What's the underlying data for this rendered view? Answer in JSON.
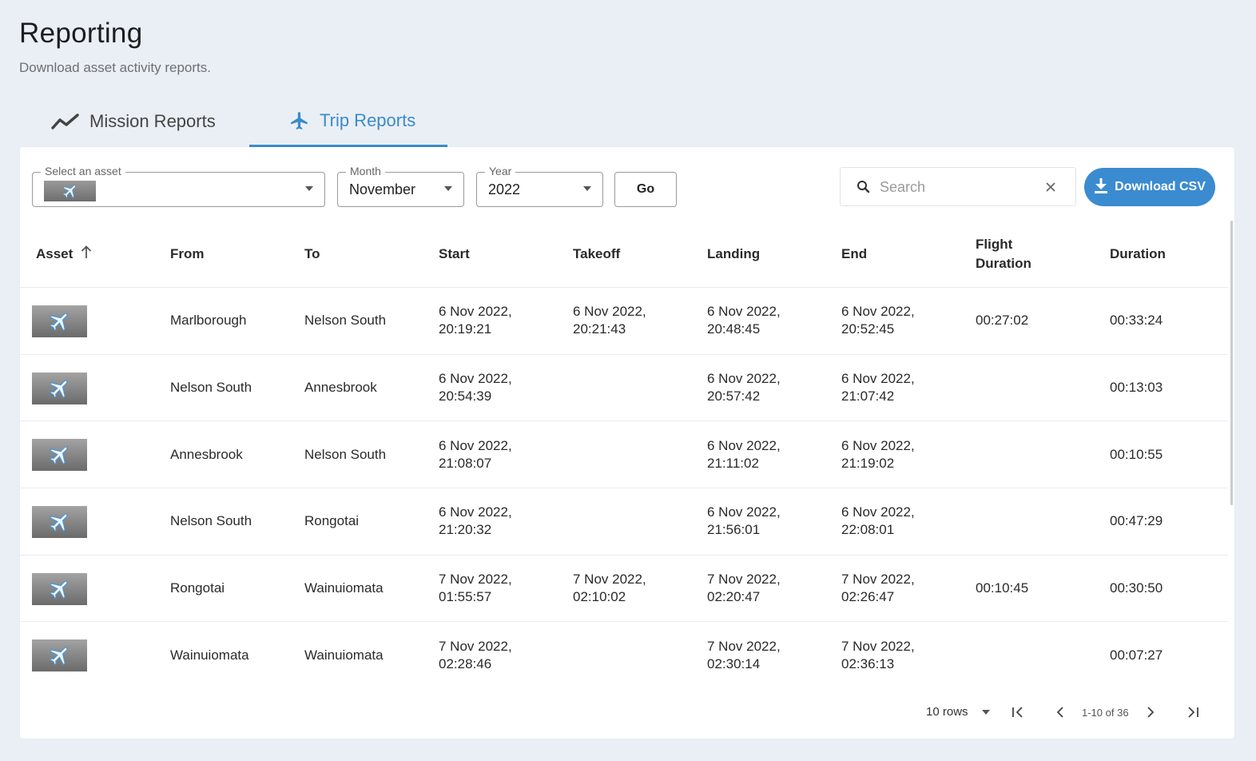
{
  "page": {
    "title": "Reporting",
    "subtitle": "Download asset activity reports."
  },
  "tabs": [
    {
      "label": "Mission Reports",
      "icon": "trend-line-icon",
      "active": false
    },
    {
      "label": "Trip Reports",
      "icon": "airplane-icon",
      "active": true
    }
  ],
  "filters": {
    "asset": {
      "label": "Select an asset",
      "value_icon": "airplane-emoji"
    },
    "month": {
      "label": "Month",
      "value": "November"
    },
    "year": {
      "label": "Year",
      "value": "2022"
    },
    "go_label": "Go",
    "search_placeholder": "Search",
    "download_label": "Download CSV"
  },
  "table": {
    "columns": [
      "Asset",
      "From",
      "To",
      "Start",
      "Takeoff",
      "Landing",
      "End",
      "Flight Duration",
      "Duration"
    ],
    "rows": [
      {
        "from": "Marlborough",
        "to": "Nelson South",
        "start": [
          "6 Nov 2022,",
          "20:19:21"
        ],
        "takeoff": [
          "6 Nov 2022,",
          "20:21:43"
        ],
        "landing": [
          "6 Nov 2022,",
          "20:48:45"
        ],
        "end": [
          "6 Nov 2022,",
          "20:52:45"
        ],
        "flight_duration": "00:27:02",
        "duration": "00:33:24"
      },
      {
        "from": "Nelson South",
        "to": "Annesbrook",
        "start": [
          "6 Nov 2022,",
          "20:54:39"
        ],
        "takeoff": [
          "",
          ""
        ],
        "landing": [
          "6 Nov 2022,",
          "20:57:42"
        ],
        "end": [
          "6 Nov 2022,",
          "21:07:42"
        ],
        "flight_duration": "",
        "duration": "00:13:03"
      },
      {
        "from": "Annesbrook",
        "to": "Nelson South",
        "start": [
          "6 Nov 2022,",
          "21:08:07"
        ],
        "takeoff": [
          "",
          ""
        ],
        "landing": [
          "6 Nov 2022,",
          "21:11:02"
        ],
        "end": [
          "6 Nov 2022,",
          "21:19:02"
        ],
        "flight_duration": "",
        "duration": "00:10:55"
      },
      {
        "from": "Nelson South",
        "to": "Rongotai",
        "start": [
          "6 Nov 2022,",
          "21:20:32"
        ],
        "takeoff": [
          "",
          ""
        ],
        "landing": [
          "6 Nov 2022,",
          "21:56:01"
        ],
        "end": [
          "6 Nov 2022,",
          "22:08:01"
        ],
        "flight_duration": "",
        "duration": "00:47:29"
      },
      {
        "from": "Rongotai",
        "to": "Wainuiomata",
        "start": [
          "7 Nov 2022,",
          "01:55:57"
        ],
        "takeoff": [
          "7 Nov 2022,",
          "02:10:02"
        ],
        "landing": [
          "7 Nov 2022,",
          "02:20:47"
        ],
        "end": [
          "7 Nov 2022,",
          "02:26:47"
        ],
        "flight_duration": "00:10:45",
        "duration": "00:30:50"
      },
      {
        "from": "Wainuiomata",
        "to": "Wainuiomata",
        "start": [
          "7 Nov 2022,",
          "02:28:46"
        ],
        "takeoff": [
          "",
          ""
        ],
        "landing": [
          "7 Nov 2022,",
          "02:30:14"
        ],
        "end": [
          "7 Nov 2022,",
          "02:36:13"
        ],
        "flight_duration": "",
        "duration": "00:07:27"
      }
    ]
  },
  "pagination": {
    "rows_per_page": "10 rows",
    "range": "1-10 of 36"
  },
  "colors": {
    "accent": "#3b8bd0",
    "background": "#eaeff6"
  }
}
